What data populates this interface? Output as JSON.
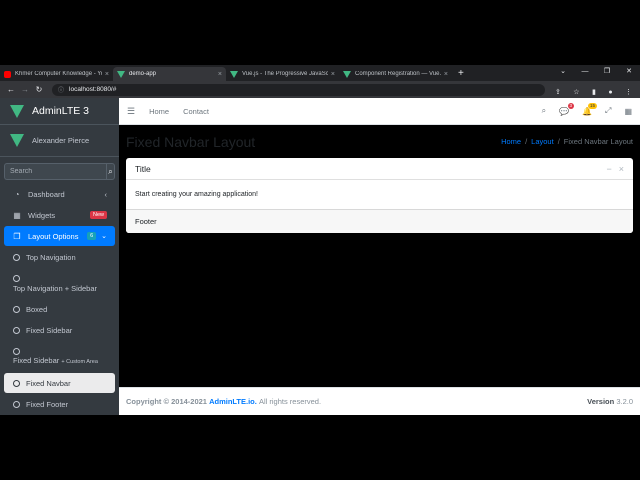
{
  "browser": {
    "tabs": [
      {
        "title": "Khmer Computer Knowledge - Yo",
        "favicon": "youtube",
        "active": false
      },
      {
        "title": "demo-app",
        "favicon": "vue",
        "active": true
      },
      {
        "title": "Vue.js - The Progressive JavaScript",
        "favicon": "vue",
        "active": false
      },
      {
        "title": "Component Registration — Vue.js",
        "favicon": "vue",
        "active": false
      }
    ],
    "url": "localhost:8080/#",
    "new_tab_glyph": "+",
    "close_glyph": "×"
  },
  "sidebar": {
    "brand": "AdminLTE 3",
    "user_name": "Alexander Pierce",
    "search_placeholder": "Search",
    "menu": [
      {
        "label": "Dashboard",
        "icon": "dashboard-icon"
      },
      {
        "label": "Widgets",
        "icon": "widgets-icon",
        "badge": "New"
      },
      {
        "label": "Layout Options",
        "icon": "copy-icon",
        "badge": "6"
      }
    ],
    "submenu": [
      {
        "label": "Top Navigation"
      },
      {
        "label": "Top Navigation + Sidebar"
      },
      {
        "label": "Boxed"
      },
      {
        "label": "Fixed Sidebar"
      },
      {
        "label": "Fixed Sidebar",
        "small": "+ Custom Area"
      },
      {
        "label": "Fixed Navbar"
      },
      {
        "label": "Fixed Footer"
      }
    ]
  },
  "navbar": {
    "links": [
      "Home",
      "Contact"
    ],
    "messages_count": "3",
    "notifications_count": "15"
  },
  "content": {
    "title": "Fixed Navbar Layout",
    "breadcrumb": [
      "Home",
      "Layout",
      "Fixed Navbar Layout"
    ],
    "card": {
      "title": "Title",
      "body": "Start creating your amazing application!",
      "footer": "Footer"
    }
  },
  "footer": {
    "copyright_prefix": "Copyright © 2014-2021",
    "brand": "AdminLTE.io.",
    "rights": "All rights reserved.",
    "version_label": "Version",
    "version": "3.2.0"
  },
  "colors": {
    "primary": "#007bff",
    "sidebar_bg": "#343a40",
    "vue_green": "#41b883",
    "danger": "#dc3545",
    "warning": "#ffc107"
  }
}
